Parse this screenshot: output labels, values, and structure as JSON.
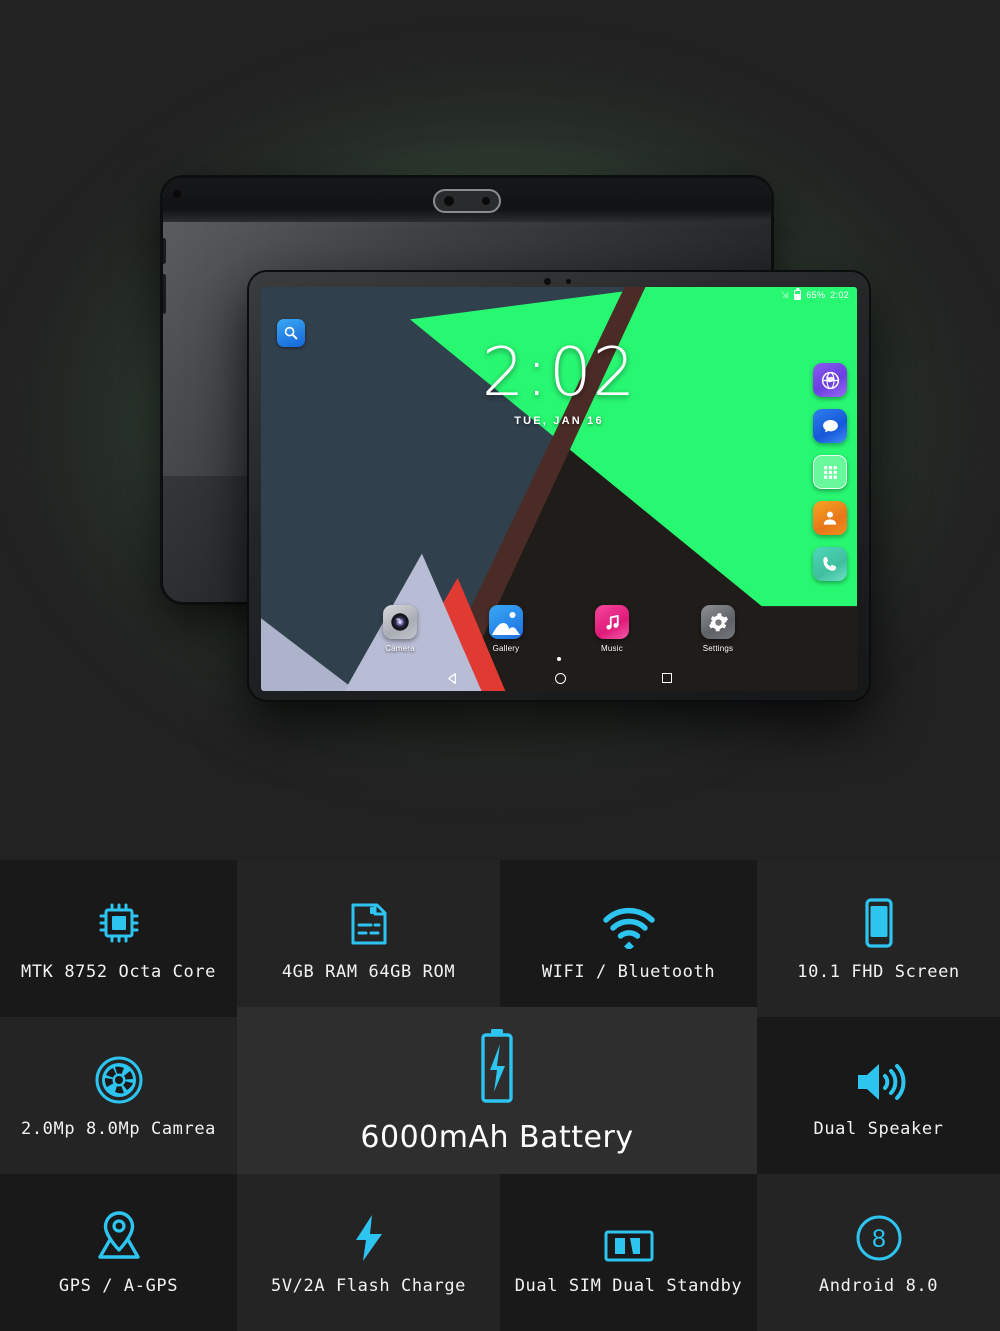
{
  "theme": {
    "background": "#222222",
    "accent_cyan": "#2ec4f0",
    "glow_green": "#9fd9a4",
    "cell_dark": "#191919",
    "cell_light": "#242424",
    "battery_panel_bg": "#2e2e2e",
    "text_white": "#f2f2f2"
  },
  "hero": {
    "back_tablet": {
      "name": "tablet-rear-view",
      "camera_module": "dual-camera-module"
    },
    "front_tablet": {
      "name": "tablet-front-view",
      "screen": {
        "status_bar": {
          "signal_icon": "signal-off-icon",
          "battery_icon": "battery-icon",
          "battery_percent": "65%",
          "time": "2:02"
        },
        "search_widget": {
          "icon": "search-icon"
        },
        "clock": {
          "time": "2:02",
          "date": "TUE, JAN 16"
        },
        "side_dock": [
          {
            "label": "Browser",
            "icon": "globe-icon"
          },
          {
            "label": "Messages",
            "icon": "speech-bubble-icon"
          },
          {
            "label": "App Drawer",
            "icon": "grid-icon"
          },
          {
            "label": "Contacts",
            "icon": "person-icon"
          },
          {
            "label": "Phone",
            "icon": "phone-icon"
          }
        ],
        "dock": [
          {
            "label": "Camera",
            "icon": "camera-icon"
          },
          {
            "label": "Gallery",
            "icon": "photo-icon"
          },
          {
            "label": "Music",
            "icon": "music-note-icon"
          },
          {
            "label": "Settings",
            "icon": "gear-icon"
          }
        ],
        "nav_bar": [
          {
            "label": "Back",
            "icon": "triangle-back-icon"
          },
          {
            "label": "Home",
            "icon": "circle-home-icon"
          },
          {
            "label": "Recents",
            "icon": "square-recents-icon"
          }
        ]
      }
    }
  },
  "features": [
    {
      "label": "MTK 8752  Octa Core",
      "icon": "cpu-chip-icon",
      "shade": "dark"
    },
    {
      "label": "4GB RAM  64GB ROM",
      "icon": "memory-card-icon",
      "shade": "light"
    },
    {
      "label": "WIFI / Bluetooth",
      "icon": "wifi-icon",
      "shade": "dark"
    },
    {
      "label": "10.1 FHD Screen",
      "icon": "screen-icon",
      "shade": "light"
    },
    {
      "label": "2.0Mp 8.0Mp Camrea",
      "icon": "aperture-icon",
      "shade": "light"
    },
    {
      "label": "",
      "icon": "",
      "shade": "dark"
    },
    {
      "label": "",
      "icon": "",
      "shade": "light"
    },
    {
      "label": "Dual Speaker",
      "icon": "speaker-icon",
      "shade": "dark"
    },
    {
      "label": "GPS / A-GPS",
      "icon": "location-pin-icon",
      "shade": "dark"
    },
    {
      "label": "5V/2A Flash Charge",
      "icon": "lightning-bolt-icon",
      "shade": "light"
    },
    {
      "label": "Dual SIM Dual Standby",
      "icon": "dual-sim-icon",
      "shade": "dark"
    },
    {
      "label": "Android 8.0",
      "icon": "android-8-icon",
      "shade": "light"
    }
  ],
  "battery_feature": {
    "label": "6000mAh Battery",
    "icon": "battery-charging-icon"
  }
}
